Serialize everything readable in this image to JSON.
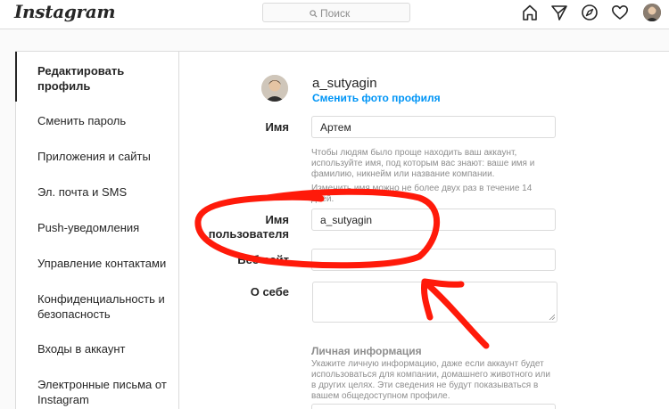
{
  "header": {
    "logo_text": "Instagram",
    "search_placeholder": "Поиск",
    "icons": [
      "home-icon",
      "direct-icon",
      "explore-icon",
      "activity-heart-icon",
      "profile-avatar-icon"
    ]
  },
  "sidebar": {
    "items": [
      {
        "label": "Редактировать профиль",
        "active": true
      },
      {
        "label": "Сменить пароль"
      },
      {
        "label": "Приложения и сайты"
      },
      {
        "label": "Эл. почта и SMS"
      },
      {
        "label": "Push-уведомления"
      },
      {
        "label": "Управление контактами"
      },
      {
        "label": "Конфиденциальность и безопасность"
      },
      {
        "label": "Входы в аккаунт"
      },
      {
        "label": "Электронные письма от Instagram"
      }
    ]
  },
  "profile": {
    "username": "a_sutyagin",
    "change_photo": "Сменить фото профиля"
  },
  "form": {
    "name_label": "Имя",
    "name_value": "Артем",
    "name_hint": "Чтобы людям было проще находить ваш аккаунт, используйте имя, под которым вас знают: ваше имя и фамилию, никнейм или название компании.",
    "name_limit": "Изменить имя можно не более двух раз в течение 14 дней.",
    "username_label": "Имя пользователя",
    "username_value": "a_sutyagin",
    "website_label": "Веб-сайт",
    "website_value": "",
    "bio_label": "О себе",
    "bio_value": "",
    "personal_title": "Личная информация",
    "personal_hint": "Укажите личную информацию, даже если аккаунт будет использоваться для компании, домашнего животного или в других целях. Эти сведения не будут показываться в вашем общедоступном профиле."
  },
  "colors": {
    "accent": "#0095f6",
    "annotation": "#ff1a0a",
    "border": "#dbdbdb"
  }
}
